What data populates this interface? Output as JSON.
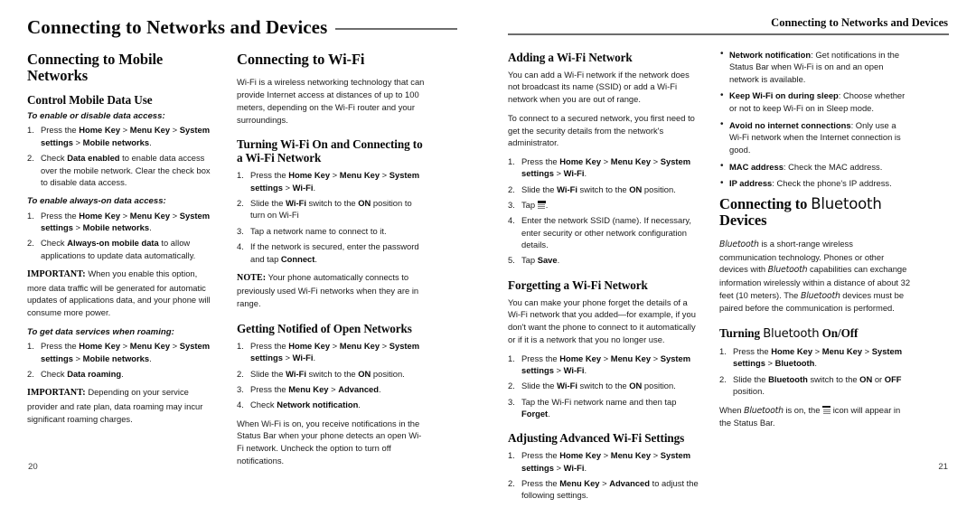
{
  "document": {
    "running_head_left": "Connecting to Networks and Devices",
    "running_head_right": "Connecting to Networks and Devices",
    "folio_left": "20",
    "folio_right": "21"
  },
  "column1": {
    "section_title": "Connecting to Mobile Networks",
    "sub1": "Control Mobile Data Use",
    "italic1": "To enable or disable data access:",
    "c1_s1_num": "1.",
    "c1_s1_a": "Press the ",
    "c1_s1_b": "Home Key",
    "c1_s1_c": " > ",
    "c1_s1_d": "Menu Key",
    "c1_s1_e": " > ",
    "c1_s1_f": "System settings",
    "c1_s1_g": " > ",
    "c1_s1_h": "Mobile networks",
    "c1_s1_i": ".",
    "c1_s2_num": "2.",
    "c1_s2_a": "Check ",
    "c1_s2_b": "Data enabled",
    "c1_s2_c": " to enable data access over the mobile network. Clear the check box to disable data access.",
    "italic2": "To enable always-on data access:",
    "c1_s3_num": "1.",
    "c1_s3_a": "Press the ",
    "c1_s3_b": "Home Key",
    "c1_s3_c": " > ",
    "c1_s3_d": "Menu Key",
    "c1_s3_e": " > ",
    "c1_s3_f": "System settings",
    "c1_s3_g": " > ",
    "c1_s3_h": "Mobile networks",
    "c1_s3_i": ".",
    "c1_s4_num": "2.",
    "c1_s4_a": "Check ",
    "c1_s4_b": "Always-on mobile data",
    "c1_s4_c": " to allow applications to update data automatically.",
    "important1_label": "IMPORTANT:",
    "important1_text": " When you enable this option, more data traffic will be generated for automatic updates of applications data, and your phone will consume more power.",
    "italic3": "To get data services when roaming:",
    "c1_s5_num": "1.",
    "c1_s5_a": "Press the ",
    "c1_s5_b": "Home Key",
    "c1_s5_c": " > ",
    "c1_s5_d": "Menu Key",
    "c1_s5_e": " > ",
    "c1_s5_f": "System settings",
    "c1_s5_g": " > ",
    "c1_s5_h": "Mobile networks",
    "c1_s5_i": ".",
    "c1_s6_num": "2.",
    "c1_s6_a": "Check ",
    "c1_s6_b": "Data roaming",
    "c1_s6_c": ".",
    "important2_label": "IMPORTANT:",
    "important2_text": " Depending on your service provider and rate plan, data roaming may incur significant roaming charges."
  },
  "column2": {
    "section_title": "Connecting to Wi-Fi",
    "intro": "Wi-Fi is a wireless networking technology that can provide Internet access at distances of up to 100 meters, depending on the Wi-Fi router and your surroundings.",
    "sub1": "Turning Wi-Fi On and Connecting to a Wi-Fi Network",
    "c2_s1_num": "1.",
    "c2_s1_a": "Press the ",
    "c2_s1_b": "Home Key",
    "c2_s1_c": " > ",
    "c2_s1_d": "Menu Key",
    "c2_s1_e": " > ",
    "c2_s1_f": "System settings",
    "c2_s1_g": " > ",
    "c2_s1_h": "Wi-Fi",
    "c2_s1_i": ".",
    "c2_s2_num": "2.",
    "c2_s2_a": "Slide the ",
    "c2_s2_b": "Wi-Fi",
    "c2_s2_c": " switch to the ",
    "c2_s2_d": "ON",
    "c2_s2_e": " position to turn on Wi-Fi",
    "c2_s3_num": "3.",
    "c2_s3_a": "Tap a network name to connect to it.",
    "c2_s4_num": "4.",
    "c2_s4_a": "If the network is secured, enter the password and tap ",
    "c2_s4_b": "Connect",
    "c2_s4_c": ".",
    "note_label": "NOTE:",
    "note_text": " Your phone automatically connects to previously used Wi-Fi networks when they are in range.",
    "sub2": "Getting Notified of Open Networks",
    "c2_s5_num": "1.",
    "c2_s5_a": "Press the ",
    "c2_s5_b": "Home Key",
    "c2_s5_c": " > ",
    "c2_s5_d": "Menu Key",
    "c2_s5_e": " > ",
    "c2_s5_f": "System settings",
    "c2_s5_g": " > ",
    "c2_s5_h": "Wi-Fi",
    "c2_s5_i": ".",
    "c2_s6_num": "2.",
    "c2_s6_a": "Slide the ",
    "c2_s6_b": "Wi-Fi",
    "c2_s6_c": " switch to the ",
    "c2_s6_d": "ON",
    "c2_s6_e": " position.",
    "c2_s7_num": "3.",
    "c2_s7_a": "Press the ",
    "c2_s7_b": "Menu Key",
    "c2_s7_c": " > ",
    "c2_s7_d": "Advanced",
    "c2_s7_e": ".",
    "c2_s8_num": "4.",
    "c2_s8_a": "Check ",
    "c2_s8_b": "Network notification",
    "c2_s8_c": ".",
    "outro": "When Wi-Fi is on, you receive notifications in the Status Bar when your phone detects an open Wi-Fi network. Uncheck the option to turn off notifications."
  },
  "column3": {
    "sub1": "Adding a Wi-Fi Network",
    "p1": "You can add a Wi-Fi network if the network does not broadcast its name (SSID) or add a Wi-Fi network when you are out of range.",
    "p2": "To connect to a secured network, you first need to get the security details from the network's administrator.",
    "c3_s1_num": "1.",
    "c3_s1_a": "Press the ",
    "c3_s1_b": "Home Key",
    "c3_s1_c": " > ",
    "c3_s1_d": "Menu Key",
    "c3_s1_e": " > ",
    "c3_s1_f": "System settings",
    "c3_s1_g": " > ",
    "c3_s1_h": "Wi-Fi",
    "c3_s1_i": ".",
    "c3_s2_num": "2.",
    "c3_s2_a": "Slide the ",
    "c3_s2_b": "Wi-Fi",
    "c3_s2_c": " switch to the ",
    "c3_s2_d": "ON",
    "c3_s2_e": " position.",
    "c3_s3_num": "3.",
    "c3_s3_a": "Tap ",
    "c3_s3_icon": "add-network-icon",
    "c3_s3_b": ".",
    "c3_s4_num": "4.",
    "c3_s4_a": "Enter the network SSID (name). If necessary, enter security or other network configuration details.",
    "c3_s5_num": "5.",
    "c3_s5_a": "Tap ",
    "c3_s5_b": "Save",
    "c3_s5_c": ".",
    "sub2": "Forgetting a Wi-Fi Network",
    "p3": "You can make your phone forget the details of a Wi-Fi network that you added—for example, if you don't want the phone to connect to it automatically or if it is a network that you no longer use.",
    "c3_s6_num": "1.",
    "c3_s6_a": "Press the ",
    "c3_s6_b": "Home Key",
    "c3_s6_c": " > ",
    "c3_s6_d": "Menu Key",
    "c3_s6_e": " > ",
    "c3_s6_f": "System settings",
    "c3_s6_g": " > ",
    "c3_s6_h": "Wi-Fi",
    "c3_s6_i": ".",
    "c3_s7_num": "2.",
    "c3_s7_a": "Slide the ",
    "c3_s7_b": "Wi-Fi",
    "c3_s7_c": " switch to the ",
    "c3_s7_d": "ON",
    "c3_s7_e": " position.",
    "c3_s8_num": "3.",
    "c3_s8_a": "Tap the Wi-Fi network name and then tap ",
    "c3_s8_b": "Forget",
    "c3_s8_c": ".",
    "sub3": "Adjusting Advanced Wi-Fi Settings",
    "c3_s9_num": "1.",
    "c3_s9_a": "Press the ",
    "c3_s9_b": "Home Key",
    "c3_s9_c": " > ",
    "c3_s9_d": "Menu Key",
    "c3_s9_e": " > ",
    "c3_s9_f": "System settings",
    "c3_s9_g": " > ",
    "c3_s9_h": "Wi-Fi",
    "c3_s9_i": ".",
    "c3_s10_num": "2.",
    "c3_s10_a": "Press the ",
    "c3_s10_b": "Menu Key",
    "c3_s10_c": " > ",
    "c3_s10_d": "Advanced",
    "c3_s10_e": " to adjust the following settings."
  },
  "column4": {
    "b1_label": "Network notification",
    "b1_text": ": Get notifications in the Status Bar when Wi-Fi is on and an open network is available.",
    "b2_label": "Keep Wi-Fi on during sleep",
    "b2_text": ": Choose whether or not to keep Wi-Fi on in Sleep mode.",
    "b3_label": "Avoid no internet connections",
    "b3_text": ": Only use a Wi-Fi network when the Internet connection is good.",
    "b4_label": "MAC address",
    "b4_text": ": Check the MAC address.",
    "b5_label": "IP address",
    "b5_text": ": Check the phone's IP address.",
    "section_title_a": "Connecting to ",
    "section_title_b": "Bluetooth",
    "section_title_c": " Devices",
    "p1_a": "Bluetooth",
    "p1_b": " is a short-range wireless communication technology. Phones or other devices with ",
    "p1_c": "Bluetooth",
    "p1_d": " capabilities can exchange information wirelessly within a distance of about 32 feet (10 meters). The ",
    "p1_e": "Bluetooth",
    "p1_f": " devices must be paired before the communication is performed.",
    "sub1_a": "Turning ",
    "sub1_b": "Bluetooth",
    "sub1_c": " On/Off",
    "c4_s1_num": "1.",
    "c4_s1_a": "Press the ",
    "c4_s1_b": "Home Key",
    "c4_s1_c": " > ",
    "c4_s1_d": "Menu Key",
    "c4_s1_e": " > ",
    "c4_s1_f": "System settings",
    "c4_s1_g": " > ",
    "c4_s1_h": "Bluetooth",
    "c4_s1_i": ".",
    "c4_s2_num": "2.",
    "c4_s2_a": "Slide the ",
    "c4_s2_b": "Bluetooth",
    "c4_s2_c": " switch to the ",
    "c4_s2_d": "ON",
    "c4_s2_e": " or ",
    "c4_s2_f": "OFF",
    "c4_s2_g": " position.",
    "outro_a": "When ",
    "outro_b": "Bluetooth",
    "outro_c": " is on, the ",
    "outro_icon": "bluetooth-status-icon",
    "outro_d": " icon will appear in the Status Bar."
  }
}
